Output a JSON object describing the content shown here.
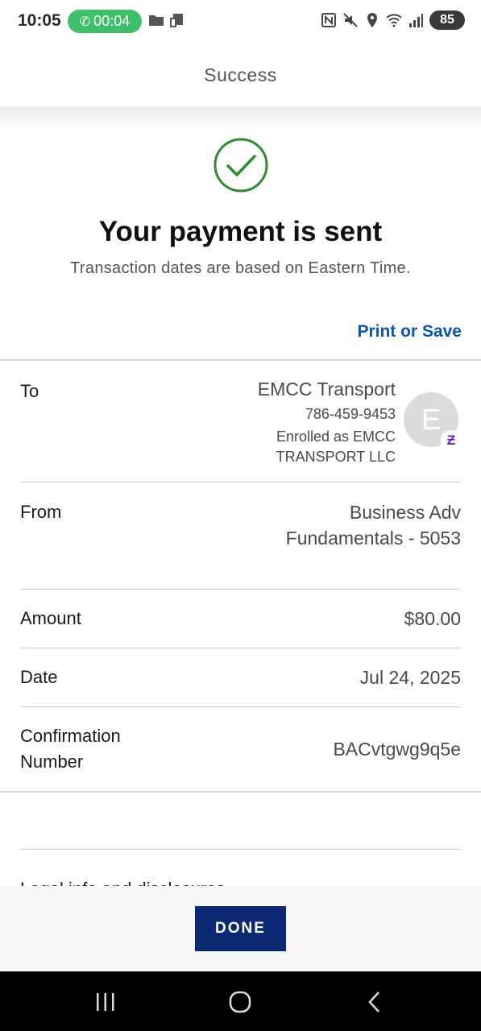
{
  "status_bar": {
    "time": "10:05",
    "call_timer": "00:04",
    "battery": "85"
  },
  "header": {
    "title": "Success"
  },
  "confirmation": {
    "headline": "Your payment is sent",
    "subtext": "Transaction dates are based on Eastern Time.",
    "print_link": "Print or Save"
  },
  "details": {
    "to_label": "To",
    "to_name": "EMCC Transport",
    "to_phone": "786-459-9453",
    "to_enrolled": "Enrolled as EMCC TRANSPORT LLC",
    "avatar_initial": "E",
    "from_label": "From",
    "from_value_line1": "Business Adv",
    "from_value_line2": "Fundamentals - 5053",
    "amount_label": "Amount",
    "amount_value": "$80.00",
    "date_label": "Date",
    "date_value": "Jul 24, 2025",
    "confirmation_label_line1": "Confirmation",
    "confirmation_label_line2": "Number",
    "confirmation_value": "BACvtgwg9q5e"
  },
  "cutoff_text": "Legal info and disclosures",
  "footer": {
    "done_label": "DONE"
  },
  "colors": {
    "accent_link": "#0a57a8",
    "done_button": "#0b2a73",
    "success_green": "#2e8b2e",
    "call_pill": "#3fbf6a",
    "zelle_purple": "#6d1ed4"
  },
  "icons": [
    "phone-icon",
    "folder-icon",
    "cast-icon",
    "nfc-icon",
    "mute-icon",
    "location-icon",
    "wifi-icon",
    "signal-icon",
    "battery-icon",
    "checkmark-circle-icon",
    "zelle-icon",
    "recents-icon",
    "home-icon",
    "back-icon"
  ]
}
